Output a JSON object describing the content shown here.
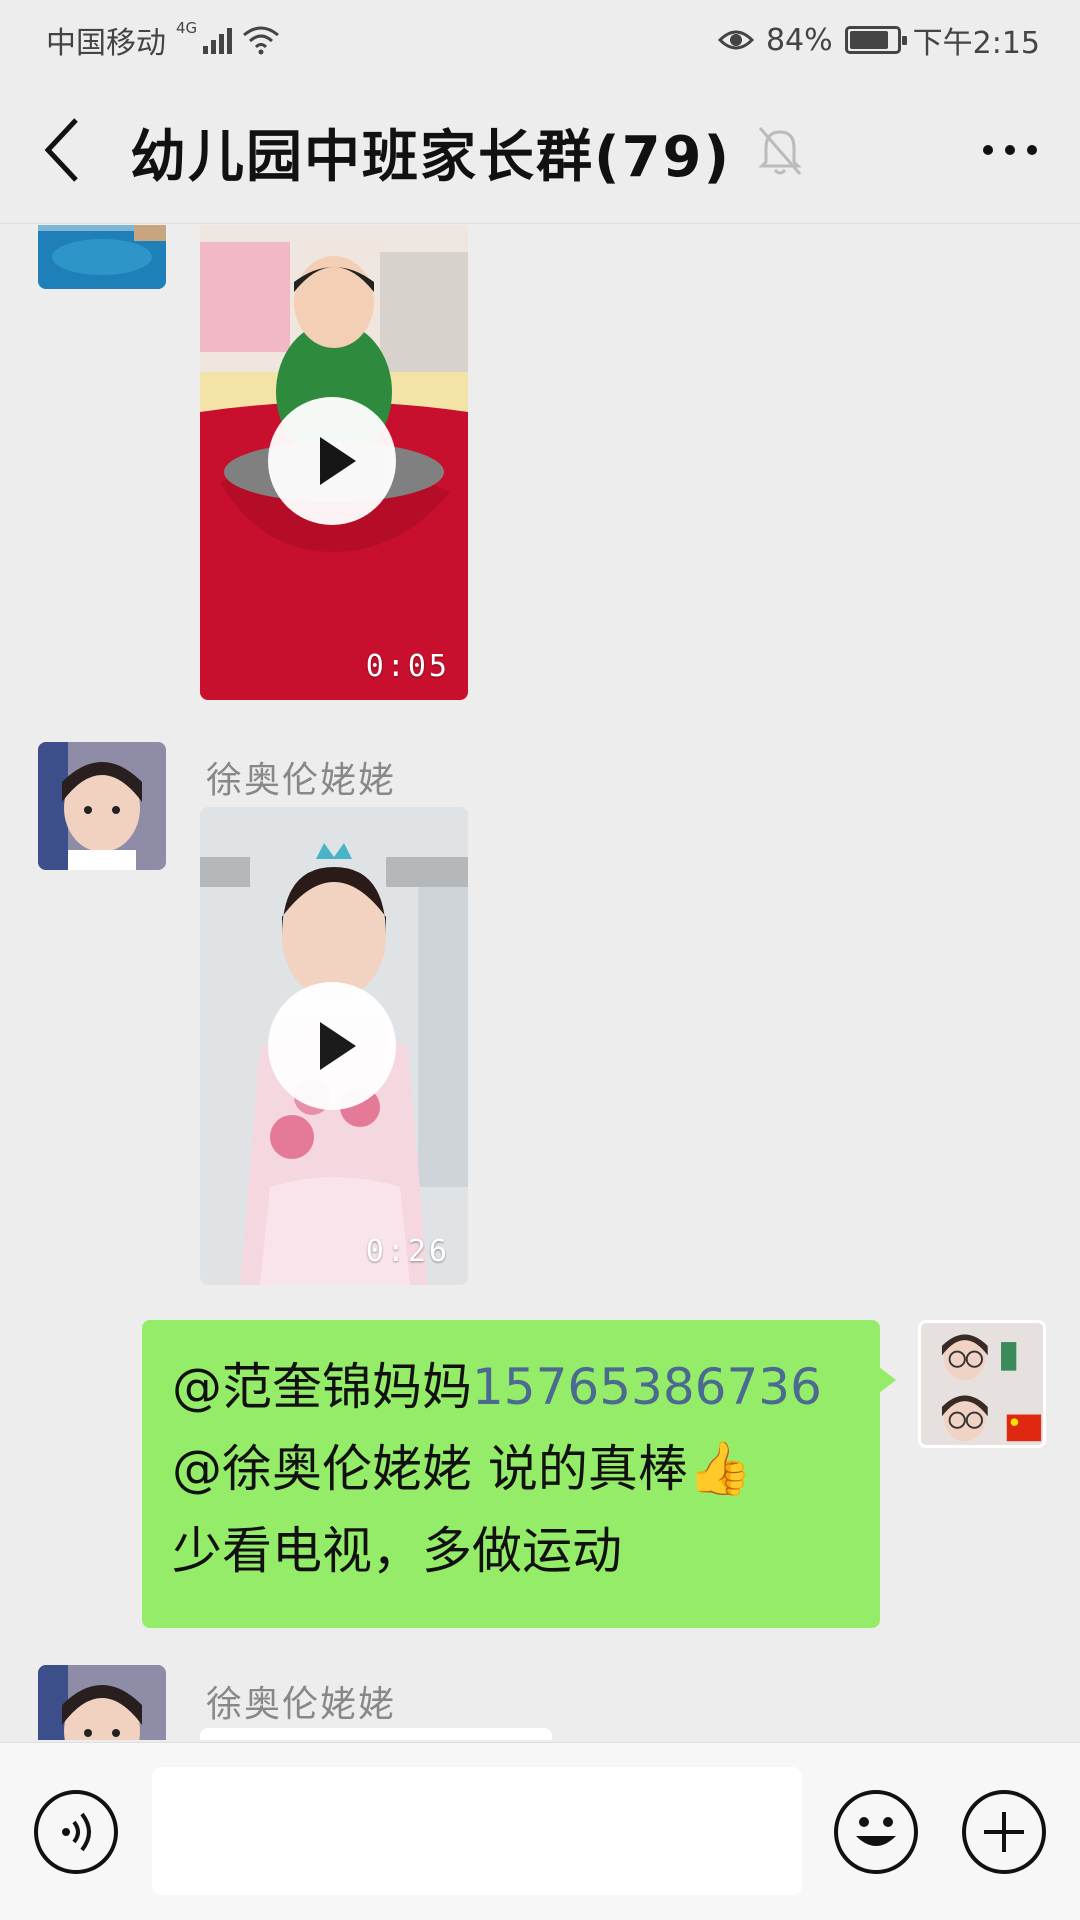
{
  "status_bar": {
    "carrier": "中国移动",
    "network": "4G",
    "battery_percent_text": "84%",
    "battery_level": 0.84,
    "time": "下午2:15"
  },
  "header": {
    "title": "幼儿园中班家长群(79)"
  },
  "messages": [
    {
      "type": "video",
      "duration": "0:05"
    },
    {
      "type": "video",
      "sender": "徐奥伦姥姥",
      "duration": "0:26"
    },
    {
      "type": "text",
      "line1_mention": "@范奎锦妈妈",
      "line1_phone": "15765386736",
      "line2": "@徐奥伦姥姥  说的真棒",
      "line2_emoji": "👍",
      "line3": "少看电视，多做运动"
    },
    {
      "type": "partial",
      "sender": "徐奥伦姥姥"
    }
  ],
  "colors": {
    "background": "#ededed",
    "own_bubble": "#95ec69",
    "phone_link": "#4a6b8f"
  },
  "icons": {
    "back": "chevron-left-icon",
    "mute": "bell-off-icon",
    "more": "more-horizontal-icon",
    "voice": "voice-icon",
    "emoji": "emoji-icon",
    "plus": "plus-icon"
  }
}
